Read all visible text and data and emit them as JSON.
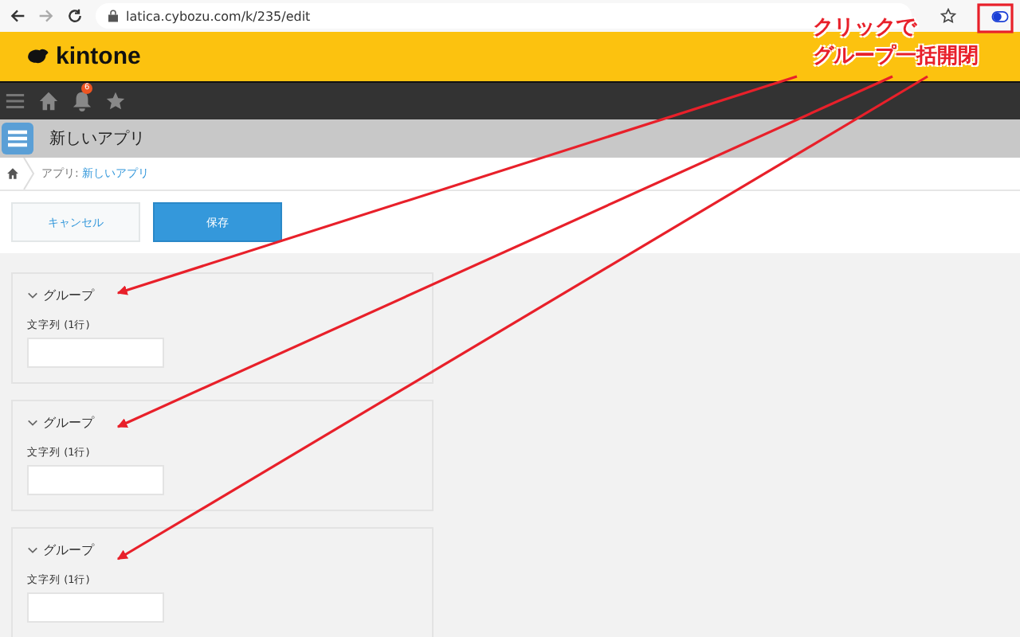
{
  "browser": {
    "url": "latica.cybozu.com/k/235/edit"
  },
  "header": {
    "logo": "kintone"
  },
  "nav": {
    "notification_count": "6"
  },
  "app": {
    "title": "新しいアプリ"
  },
  "breadcrumb": {
    "prefix": "アプリ:",
    "link": "新しいアプリ"
  },
  "buttons": [
    {
      "label": "キャンセル",
      "kind": "secondary"
    },
    {
      "label": "保存",
      "kind": "primary"
    }
  ],
  "groups": [
    {
      "title": "グループ",
      "expanded": true,
      "field_label": "文字列 (1行)"
    },
    {
      "title": "グループ",
      "expanded": true,
      "field_label": "文字列 (1行)"
    },
    {
      "title": "グループ",
      "expanded": true,
      "field_label": "文字列 (1行)"
    }
  ],
  "annotation": {
    "lines": [
      "クリックで",
      "グループ一括開閉"
    ]
  }
}
